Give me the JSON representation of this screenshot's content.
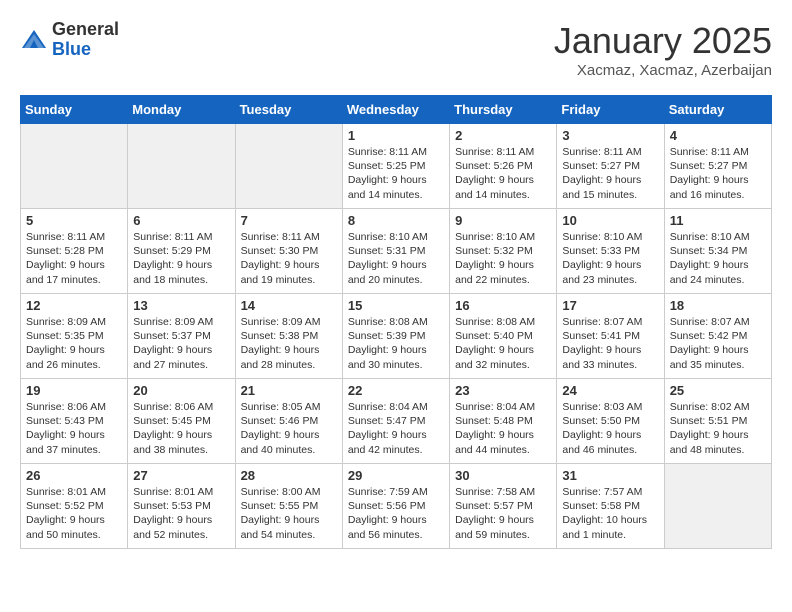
{
  "header": {
    "logo_general": "General",
    "logo_blue": "Blue",
    "title": "January 2025",
    "subtitle": "Xacmaz, Xacmaz, Azerbaijan"
  },
  "weekdays": [
    "Sunday",
    "Monday",
    "Tuesday",
    "Wednesday",
    "Thursday",
    "Friday",
    "Saturday"
  ],
  "weeks": [
    [
      {
        "day": "",
        "info": ""
      },
      {
        "day": "",
        "info": ""
      },
      {
        "day": "",
        "info": ""
      },
      {
        "day": "1",
        "info": "Sunrise: 8:11 AM\nSunset: 5:25 PM\nDaylight: 9 hours\nand 14 minutes."
      },
      {
        "day": "2",
        "info": "Sunrise: 8:11 AM\nSunset: 5:26 PM\nDaylight: 9 hours\nand 14 minutes."
      },
      {
        "day": "3",
        "info": "Sunrise: 8:11 AM\nSunset: 5:27 PM\nDaylight: 9 hours\nand 15 minutes."
      },
      {
        "day": "4",
        "info": "Sunrise: 8:11 AM\nSunset: 5:27 PM\nDaylight: 9 hours\nand 16 minutes."
      }
    ],
    [
      {
        "day": "5",
        "info": "Sunrise: 8:11 AM\nSunset: 5:28 PM\nDaylight: 9 hours\nand 17 minutes."
      },
      {
        "day": "6",
        "info": "Sunrise: 8:11 AM\nSunset: 5:29 PM\nDaylight: 9 hours\nand 18 minutes."
      },
      {
        "day": "7",
        "info": "Sunrise: 8:11 AM\nSunset: 5:30 PM\nDaylight: 9 hours\nand 19 minutes."
      },
      {
        "day": "8",
        "info": "Sunrise: 8:10 AM\nSunset: 5:31 PM\nDaylight: 9 hours\nand 20 minutes."
      },
      {
        "day": "9",
        "info": "Sunrise: 8:10 AM\nSunset: 5:32 PM\nDaylight: 9 hours\nand 22 minutes."
      },
      {
        "day": "10",
        "info": "Sunrise: 8:10 AM\nSunset: 5:33 PM\nDaylight: 9 hours\nand 23 minutes."
      },
      {
        "day": "11",
        "info": "Sunrise: 8:10 AM\nSunset: 5:34 PM\nDaylight: 9 hours\nand 24 minutes."
      }
    ],
    [
      {
        "day": "12",
        "info": "Sunrise: 8:09 AM\nSunset: 5:35 PM\nDaylight: 9 hours\nand 26 minutes."
      },
      {
        "day": "13",
        "info": "Sunrise: 8:09 AM\nSunset: 5:37 PM\nDaylight: 9 hours\nand 27 minutes."
      },
      {
        "day": "14",
        "info": "Sunrise: 8:09 AM\nSunset: 5:38 PM\nDaylight: 9 hours\nand 28 minutes."
      },
      {
        "day": "15",
        "info": "Sunrise: 8:08 AM\nSunset: 5:39 PM\nDaylight: 9 hours\nand 30 minutes."
      },
      {
        "day": "16",
        "info": "Sunrise: 8:08 AM\nSunset: 5:40 PM\nDaylight: 9 hours\nand 32 minutes."
      },
      {
        "day": "17",
        "info": "Sunrise: 8:07 AM\nSunset: 5:41 PM\nDaylight: 9 hours\nand 33 minutes."
      },
      {
        "day": "18",
        "info": "Sunrise: 8:07 AM\nSunset: 5:42 PM\nDaylight: 9 hours\nand 35 minutes."
      }
    ],
    [
      {
        "day": "19",
        "info": "Sunrise: 8:06 AM\nSunset: 5:43 PM\nDaylight: 9 hours\nand 37 minutes."
      },
      {
        "day": "20",
        "info": "Sunrise: 8:06 AM\nSunset: 5:45 PM\nDaylight: 9 hours\nand 38 minutes."
      },
      {
        "day": "21",
        "info": "Sunrise: 8:05 AM\nSunset: 5:46 PM\nDaylight: 9 hours\nand 40 minutes."
      },
      {
        "day": "22",
        "info": "Sunrise: 8:04 AM\nSunset: 5:47 PM\nDaylight: 9 hours\nand 42 minutes."
      },
      {
        "day": "23",
        "info": "Sunrise: 8:04 AM\nSunset: 5:48 PM\nDaylight: 9 hours\nand 44 minutes."
      },
      {
        "day": "24",
        "info": "Sunrise: 8:03 AM\nSunset: 5:50 PM\nDaylight: 9 hours\nand 46 minutes."
      },
      {
        "day": "25",
        "info": "Sunrise: 8:02 AM\nSunset: 5:51 PM\nDaylight: 9 hours\nand 48 minutes."
      }
    ],
    [
      {
        "day": "26",
        "info": "Sunrise: 8:01 AM\nSunset: 5:52 PM\nDaylight: 9 hours\nand 50 minutes."
      },
      {
        "day": "27",
        "info": "Sunrise: 8:01 AM\nSunset: 5:53 PM\nDaylight: 9 hours\nand 52 minutes."
      },
      {
        "day": "28",
        "info": "Sunrise: 8:00 AM\nSunset: 5:55 PM\nDaylight: 9 hours\nand 54 minutes."
      },
      {
        "day": "29",
        "info": "Sunrise: 7:59 AM\nSunset: 5:56 PM\nDaylight: 9 hours\nand 56 minutes."
      },
      {
        "day": "30",
        "info": "Sunrise: 7:58 AM\nSunset: 5:57 PM\nDaylight: 9 hours\nand 59 minutes."
      },
      {
        "day": "31",
        "info": "Sunrise: 7:57 AM\nSunset: 5:58 PM\nDaylight: 10 hours\nand 1 minute."
      },
      {
        "day": "",
        "info": ""
      }
    ]
  ]
}
